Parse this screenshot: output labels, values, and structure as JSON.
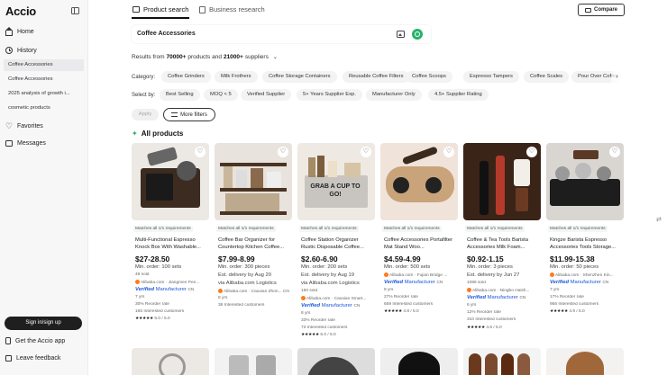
{
  "app": {
    "logo": "Accio"
  },
  "sidebar": {
    "home": "Home",
    "history": "History",
    "history_items": [
      "Coffee Accessories",
      "Coffee Accessories",
      "2025 analysis of growth i...",
      "cosmetic products"
    ],
    "favorites": "Favorites",
    "messages": "Messages",
    "signin": "Sign in/sign up",
    "get_app": "Get the Accio app",
    "feedback": "Leave feedback"
  },
  "tabs": {
    "product": "Product search",
    "business": "Business research"
  },
  "compare": "Compare",
  "search": {
    "value": "Coffee Accessories"
  },
  "results": {
    "prefix": "Results from",
    "products": "70000+",
    "mid": "products and",
    "suppliers": "21000+",
    "suffix": "suppliers"
  },
  "category": {
    "label": "Category:",
    "items": [
      "Coffee Grinders",
      "Milk Frothers",
      "Coffee Storage Containers",
      "Reusable Coffee Filters",
      "Coffee Scoops",
      "Espresso Tampers",
      "Coffee Scales",
      "Pour Over Coffee"
    ]
  },
  "selectby": {
    "label": "Select by:",
    "items": [
      "Best Selling",
      "MOQ < 5",
      "Verified Supplier",
      "5+ Years Supplier Exp.",
      "Manufacturer Only",
      "4.5+ Supplier Rating"
    ]
  },
  "apply": "Apply",
  "more_filters": "More filters",
  "all_products": "All products",
  "products": [
    {
      "match": "Matches all 1/1 requirements",
      "title": "Multi-Functional Espresso Knock Box With Washable...",
      "price": "$27-28.50",
      "moq": "Min. order: 100 sets",
      "extra": "49 sold",
      "supplier": "Alibaba.com · Jiangmen Pen...",
      "verified": "Verified",
      "mfr": "Manufacturer",
      "country": "CN",
      "years": "7 yrs",
      "reorder": "30% Reorder rate",
      "interested": "165 Interested customers",
      "rating": "5.0 / 5.0",
      "stars": "★★★★★"
    },
    {
      "match": "Matches all 1/1 requirements",
      "title": "Coffee Bar Organizer for Countertop Kitchen Coffee...",
      "price": "$7.99-8.99",
      "moq": "Min. order: 300 pieces",
      "extra": "Est. delivery by Aug 20",
      "logistics": "via Alibaba.com Logistics",
      "supplier": "Alibaba.com · Caoxian Zhon...",
      "country": "CN",
      "years": "8 yrs",
      "interested": "36 Interested customers"
    },
    {
      "match": "Matches all 1/1 requirements",
      "title": "Coffee Station Organizer Rustic Disposable Coffee...",
      "price": "$2.60-6.90",
      "moq": "Min. order: 200 sets",
      "extra": "Est. delivery by Aug 19",
      "logistics": "via Alibaba.com Logistics",
      "sold": "150 sold",
      "supplier": "Alibaba.com · Caoxian Smart...",
      "verified": "Verified",
      "mfr": "Manufacturer",
      "country": "CN",
      "years": "8 yrs",
      "reorder": "33% Reorder rate",
      "interested": "73 Interested customers",
      "rating": "5.0 / 5.0",
      "stars": "★★★★★"
    },
    {
      "match": "Matches all 1/1 requirements",
      "title": "Coffee Accessories Portafilter Mat Stand Woo...",
      "price": "$4.59-4.99",
      "moq": "Min. order: 500 sets",
      "supplier": "Alibaba.com · Fujian Bridge ...",
      "verified": "Verified",
      "mfr": "Manufacturer",
      "country": "CN",
      "years": "8 yrs",
      "reorder": "27% Reorder rate",
      "interested": "659 Interested customers",
      "rating": "4.8 / 5.0",
      "stars": "★★★★★"
    },
    {
      "match": "Matches all 1/1 requirements",
      "title": "Coffee & Tea Tools Barista Accessories Milk Foam...",
      "price": "$0.92-1.15",
      "moq": "Min. order: 3 pieces",
      "extra": "Est. delivery by Jun 27",
      "sold": "1086 sold",
      "supplier": "Alibaba.com · Ningbo Haish...",
      "verified": "Verified",
      "mfr": "Manufacturer",
      "country": "CN",
      "years": "6 yrs",
      "reorder": "12% Reorder rate",
      "interested": "310 Interested customers",
      "rating": "4.6 / 5.0",
      "stars": "★★★★★"
    },
    {
      "match": "Matches all 1/1 requirements",
      "title": "Kingze Barista Espresso Accessories Tools Storage...",
      "price": "$11.99-15.38",
      "moq": "Min. order: 50 pieces",
      "supplier": "Alibaba.com · Shenzhen Kin...",
      "verified": "Verified",
      "mfr": "Manufacturer",
      "country": "CN",
      "years": "7 yrs",
      "reorder": "17% Reorder rate",
      "interested": "956 Interested customers",
      "rating": "4.9 / 5.0",
      "stars": "★★★★★"
    }
  ],
  "colors": {
    "accent": "#26b36a",
    "verified": "#1a56db",
    "dark": "#1f1f1f"
  }
}
